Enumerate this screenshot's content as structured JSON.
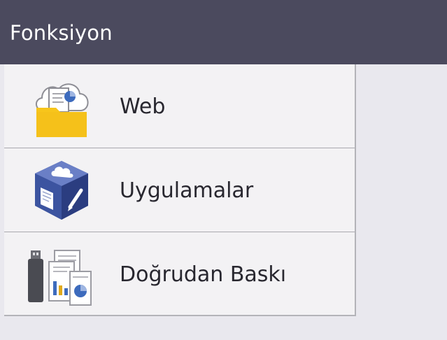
{
  "title_bar": {
    "title": "Fonksiyon"
  },
  "menu": {
    "items": [
      {
        "label": "Web",
        "icon": "web-folder-cloud-icon"
      },
      {
        "label": "Uygulamalar",
        "icon": "apps-cube-icon"
      },
      {
        "label": "Doğrudan Baskı",
        "icon": "direct-print-usb-icon"
      }
    ]
  },
  "colors": {
    "title_bar_bg": "#4b4a5e",
    "screen_bg": "#e9e8ee",
    "menu_bg": "#f3f2f4",
    "folder_yellow": "#f7c51b",
    "cube_blue": "#3a4f97",
    "usb_dark": "#4a4b52"
  }
}
